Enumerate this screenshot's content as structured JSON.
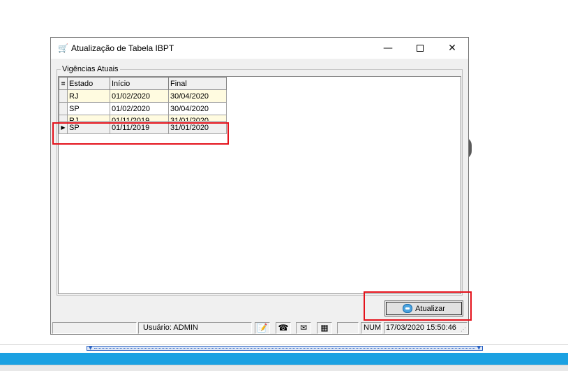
{
  "window": {
    "title": "Atualização de Tabela IBPT",
    "icon": "cart-icon",
    "controls": {
      "minimize": "—",
      "close": "✕"
    }
  },
  "group": {
    "legend": "Vigências Atuais"
  },
  "grid": {
    "columns": [
      "Estado",
      "Início",
      "Final"
    ],
    "rows": [
      {
        "estado": "RJ",
        "inicio": "01/02/2020",
        "final": "30/04/2020"
      },
      {
        "estado": "SP",
        "inicio": "01/02/2020",
        "final": "30/04/2020"
      },
      {
        "estado": "RJ",
        "inicio": "01/11/2019",
        "final": "31/01/2020"
      },
      {
        "estado": "SP",
        "inicio": "01/11/2019",
        "final": "31/01/2020"
      }
    ],
    "selected_row_indicator": "▶",
    "header_indicator": "≣"
  },
  "actions": {
    "update_label": "Atualizar"
  },
  "statusbar": {
    "user": "Usuário: ADMIN",
    "icons": [
      "notepad-icon",
      "phone-icon",
      "mail-icon",
      "calculator-icon"
    ],
    "num": "NUM",
    "datetime": "17/03/2020 15:50:46"
  },
  "colors": {
    "highlight": "#e4121b",
    "row_alt": "#fffbe0",
    "accent": "#1ba1e2"
  }
}
